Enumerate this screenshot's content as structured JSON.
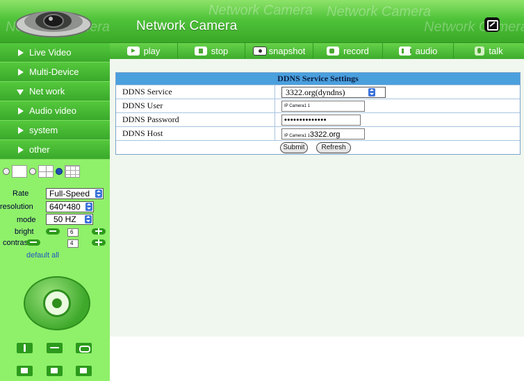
{
  "header": {
    "title": "Network Camera",
    "watermark": "Network Camera",
    "logo_icon": "camera-dome-icon",
    "fullscreen_icon": "fullscreen-icon"
  },
  "toolbar": [
    {
      "label": "play",
      "icon": "play-icon"
    },
    {
      "label": "stop",
      "icon": "stop-icon"
    },
    {
      "label": "snapshot",
      "icon": "snapshot-icon"
    },
    {
      "label": "record",
      "icon": "record-icon"
    },
    {
      "label": "audio",
      "icon": "audio-icon"
    },
    {
      "label": "talk",
      "icon": "talk-icon"
    }
  ],
  "sidebar": {
    "menu": [
      {
        "label": "Live Video",
        "expanded": false
      },
      {
        "label": "Multi-Device",
        "expanded": false
      },
      {
        "label": "Net work",
        "expanded": true
      },
      {
        "label": "Audio video",
        "expanded": false
      },
      {
        "label": "system",
        "expanded": false
      },
      {
        "label": "other",
        "expanded": false
      }
    ],
    "controls": {
      "rate_label": "Rate",
      "rate_value": "Full-Speed",
      "resolution_label": "resolution",
      "resolution_value": "640*480",
      "mode_label": "mode",
      "mode_value": "50 HZ",
      "bright_label": "bright",
      "bright_value": "6",
      "contrast_label": "contrast",
      "contrast_value": "4",
      "default_all": "default all"
    }
  },
  "ddns": {
    "heading": "DDNS Service Settings",
    "rows": [
      {
        "label": "DDNS Service",
        "value": "3322.org(dyndns)"
      },
      {
        "label": "DDNS User",
        "value": "IP Camera1 1"
      },
      {
        "label": "DDNS Password",
        "value": "••••••••••••••"
      },
      {
        "label": "DDNS Host",
        "prefix": "IP Camera1 1",
        "value": "3322.org"
      }
    ],
    "submit_label": "Submit",
    "refresh_label": "Refresh"
  },
  "colors": {
    "accent_green": "#3aa92b",
    "sidebar_bg": "#8ff06a",
    "table_header_blue": "#4a9fdd"
  }
}
